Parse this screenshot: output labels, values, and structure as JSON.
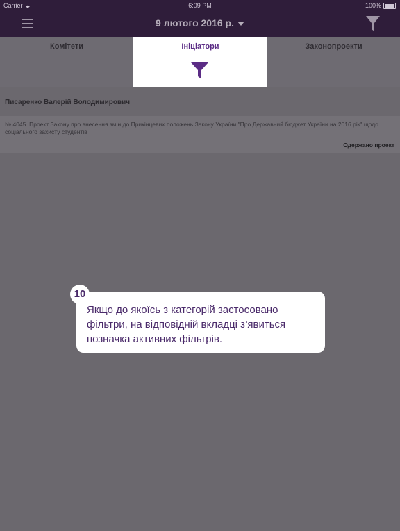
{
  "status_bar": {
    "carrier": "Carrier",
    "time": "6:09 PM",
    "battery": "100%"
  },
  "nav": {
    "title": "9 лютого 2016 р.",
    "menu_icon": "hamburger-icon",
    "filter_icon": "funnel-icon"
  },
  "tabs": [
    {
      "label": "Комітети"
    },
    {
      "label": "Ініціатори",
      "active": true
    },
    {
      "label": "Законопроекти"
    }
  ],
  "content": {
    "person": "Писаренко Валерій Володимирович",
    "bill": {
      "text": "№ 4045. Проект Закону про внесення змін до Прикінцевих положень Закону України \"Про Державний бюджет України на 2016 рік\" щодо соціального захисту студентів",
      "status": "Одержано проект"
    }
  },
  "callout": {
    "number": "10",
    "text": "Якщо до якоїсь з категорій застосовано фільтри, на відповідній вкладці з’явиться позначка активних фільтрів."
  },
  "colors": {
    "accent": "#5b2c85",
    "header": "#2f1d3a",
    "overlay": "#6b686e"
  }
}
